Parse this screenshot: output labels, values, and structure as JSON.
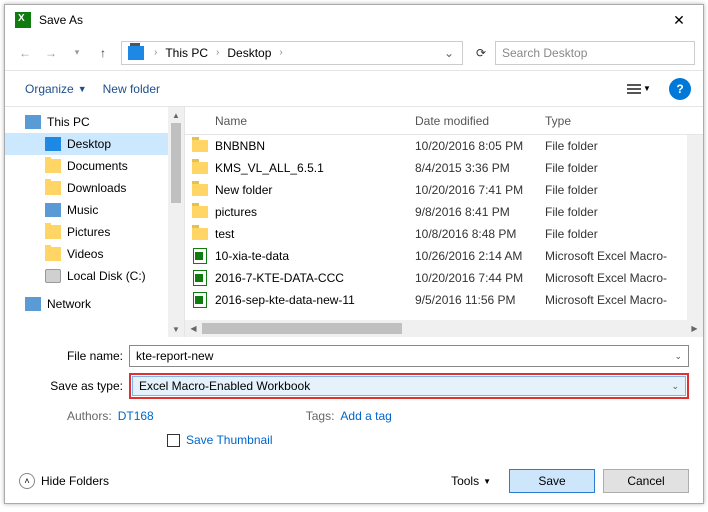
{
  "title": "Save As",
  "breadcrumb": {
    "root": "This PC",
    "loc": "Desktop"
  },
  "search_placeholder": "Search Desktop",
  "toolbar": {
    "organize": "Organize",
    "newfolder": "New folder"
  },
  "sidebar": {
    "items": [
      {
        "label": "This PC"
      },
      {
        "label": "Desktop"
      },
      {
        "label": "Documents"
      },
      {
        "label": "Downloads"
      },
      {
        "label": "Music"
      },
      {
        "label": "Pictures"
      },
      {
        "label": "Videos"
      },
      {
        "label": "Local Disk (C:)"
      },
      {
        "label": "Network"
      }
    ]
  },
  "columns": {
    "name": "Name",
    "date": "Date modified",
    "type": "Type"
  },
  "files": [
    {
      "icon": "folder",
      "name": "BNBNBN",
      "date": "10/20/2016 8:05 PM",
      "type": "File folder"
    },
    {
      "icon": "folder",
      "name": "KMS_VL_ALL_6.5.1",
      "date": "8/4/2015 3:36 PM",
      "type": "File folder"
    },
    {
      "icon": "folder",
      "name": "New folder",
      "date": "10/20/2016 7:41 PM",
      "type": "File folder"
    },
    {
      "icon": "folder",
      "name": "pictures",
      "date": "9/8/2016 8:41 PM",
      "type": "File folder"
    },
    {
      "icon": "folder",
      "name": "test",
      "date": "10/8/2016 8:48 PM",
      "type": "File folder"
    },
    {
      "icon": "xlsm",
      "name": "10-xia-te-data",
      "date": "10/26/2016 2:14 AM",
      "type": "Microsoft Excel Macro-"
    },
    {
      "icon": "xlsm",
      "name": "2016-7-KTE-DATA-CCC",
      "date": "10/20/2016 7:44 PM",
      "type": "Microsoft Excel Macro-"
    },
    {
      "icon": "xlsm",
      "name": "2016-sep-kte-data-new-11",
      "date": "9/5/2016 11:56 PM",
      "type": "Microsoft Excel Macro-"
    }
  ],
  "form": {
    "filename_label": "File name:",
    "filename_value": "kte-report-new",
    "saveas_label": "Save as type:",
    "saveas_value": "Excel Macro-Enabled Workbook",
    "authors_label": "Authors:",
    "authors_value": "DT168",
    "tags_label": "Tags:",
    "tags_value": "Add a tag",
    "thumb_label": "Save Thumbnail"
  },
  "footer": {
    "hide": "Hide Folders",
    "tools": "Tools",
    "save": "Save",
    "cancel": "Cancel"
  }
}
